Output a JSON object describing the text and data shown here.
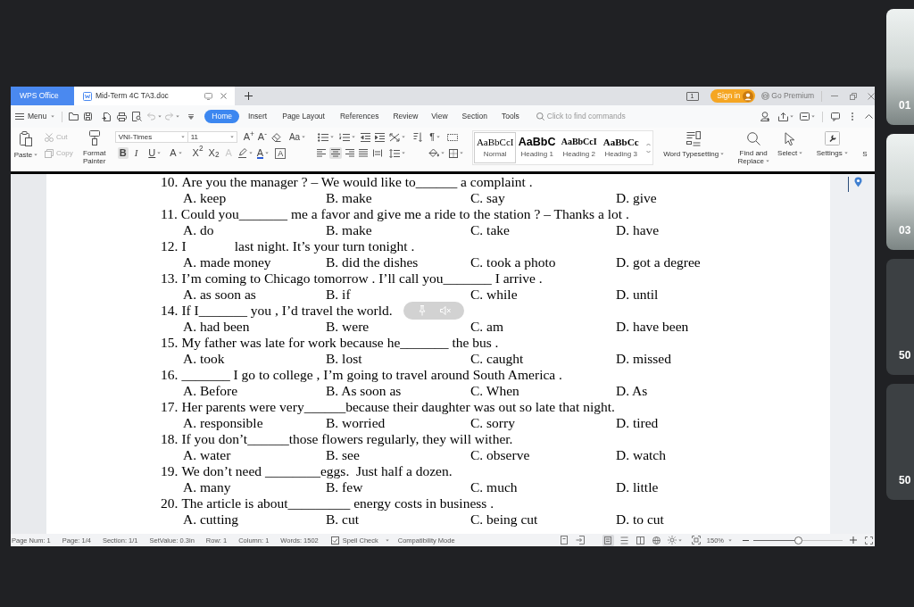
{
  "window": {
    "app_tab": "WPS Office",
    "document_tab": "Mid-Term 4C TA3.doc",
    "window_count": "1",
    "sign_in": "Sign in",
    "premium": "Go Premium"
  },
  "menu_bar": {
    "menu": "Menu",
    "tabs": [
      {
        "label": "Home",
        "selected": true
      },
      {
        "label": "Insert",
        "selected": false
      },
      {
        "label": "Page Layout",
        "selected": false
      },
      {
        "label": "References",
        "selected": false
      },
      {
        "label": "Review",
        "selected": false
      },
      {
        "label": "View",
        "selected": false
      },
      {
        "label": "Section",
        "selected": false
      },
      {
        "label": "Tools",
        "selected": false
      }
    ],
    "search": {
      "placeholder": "Click to find commands"
    }
  },
  "ribbon": {
    "paste": {
      "label": "Paste",
      "dropdown": true
    },
    "clipboard": [
      {
        "label": "Cut",
        "disabled": true
      },
      {
        "label": "Copy",
        "disabled": true
      }
    ],
    "format_painter": {
      "label": "Format Painter",
      "disabled": false
    },
    "font_name": "VNI-Times",
    "font_size": "11",
    "size_buttons": [
      "A$^{+}$",
      "A$^{-}$"
    ],
    "change_case": {
      "text": "Aa",
      "dropdown": true
    },
    "paragraph_mark": {
      "text": "¶",
      "dropdown": true
    },
    "font_styles": [
      {
        "text": "B",
        "selected": true,
        "dropdown": false,
        "disabled": false
      },
      {
        "text": "I",
        "selected": false,
        "dropdown": false,
        "disabled": false
      },
      {
        "text": "U",
        "selected": false,
        "dropdown": true,
        "disabled": false
      },
      {
        "text": "A",
        "selected": false,
        "dropdown": true,
        "disabled": false
      },
      {
        "text": "X$^{2}$",
        "selected": false,
        "dropdown": false,
        "disabled": false
      },
      {
        "text": "X$_{2}$",
        "selected": false,
        "dropdown": false,
        "disabled": false
      },
      {
        "text": "A",
        "selected": false,
        "dropdown": false,
        "disabled": true
      }
    ],
    "font_color": {
      "text": "A",
      "dropdown": true
    },
    "character_border": {
      "text": "A"
    },
    "alignment": [
      {
        "selected": false
      },
      {
        "selected": true
      },
      {
        "selected": false
      },
      {
        "selected": false
      },
      {
        "selected": false
      }
    ],
    "styles": [
      {
        "preview": "AaBbCcI",
        "label": "Normal",
        "selected": true
      },
      {
        "preview": "AaBbC",
        "label": "Heading 1",
        "selected": false
      },
      {
        "preview": "AaBbCcI",
        "label": "Heading 2",
        "selected": false
      },
      {
        "preview": "AaBbCc",
        "label": "Heading 3",
        "selected": false
      }
    ],
    "tools": [
      {
        "label": "Word Typesetting",
        "dropdown": true
      },
      {
        "label": "Find and Replace",
        "dropdown": true
      },
      {
        "label": "Select",
        "dropdown": true
      },
      {
        "label": "Settings",
        "dropdown": true
      },
      {
        "label": "S",
        "dropdown": false
      }
    ]
  },
  "document": {
    "questions": [
      {
        "number": "10.",
        "text": "Are you the manager ? – We would like to______ a complaint .",
        "options": [
          "A. keep",
          "B. make",
          "C. say",
          "D. give"
        ]
      },
      {
        "number": "11.",
        "text": "Could you_______ me a favor and give me a ride to the station ? – Thanks a lot .",
        "options": [
          "A. do",
          "B. make",
          "C. take",
          "D. have"
        ]
      },
      {
        "number": "12.",
        "text": "I              last night. It’s your turn tonight .",
        "options": [
          "A. made money",
          "B. did the dishes",
          "C. took a photo",
          "D. got a degree"
        ]
      },
      {
        "number": "13.",
        "text": "I’m coming to Chicago tomorrow . I’ll call you_______ I arrive .",
        "options": [
          "A. as soon as",
          "B. if",
          "C. while",
          "D. until"
        ]
      },
      {
        "number": "14.",
        "text": "If I_______ you , I’d travel the world.",
        "options": [
          "A. had been",
          "B. were",
          "C. am",
          "D. have been"
        ]
      },
      {
        "number": "15.",
        "text": "My father was late for work because he_______ the bus .",
        "options": [
          "A. took",
          "B. lost",
          "C. caught",
          "D. missed"
        ]
      },
      {
        "number": "16.",
        "text": "_______ I go to college , I’m going to travel around South America .",
        "options": [
          "A. Before",
          "B. As soon as",
          "C. When",
          "D. As"
        ]
      },
      {
        "number": "17.",
        "text": "Her parents were very______because their daughter was out so late that night.",
        "options": [
          "A. responsible",
          "B. worried",
          "C. sorry",
          "D. tired"
        ]
      },
      {
        "number": "18.",
        "text": "If you don’t______those flowers regularly, they will wither.",
        "options": [
          "A. water",
          "B. see",
          "C. observe",
          "D. watch"
        ]
      },
      {
        "number": "19.",
        "text": "We don’t need ________eggs.  Just half a dozen.",
        "options": [
          "A. many",
          "B. few",
          "C. much",
          "D. little"
        ]
      },
      {
        "number": "20.",
        "text": "The article is about_________ energy costs in business .",
        "options": [
          "A. cutting",
          "B. cut",
          "C. being cut",
          "D. to cut"
        ]
      }
    ]
  },
  "status_bar": {
    "fields": [
      "Page Num: 1",
      "Page: 1/4",
      "Section: 1/1",
      "SetValue: 0.3in",
      "Row: 1",
      "Column: 1",
      "Words: 1502"
    ],
    "spell_check": {
      "label": "Spell Check",
      "checked": true
    },
    "mode": "Compatibility Mode",
    "view_modes": [
      {
        "selected": true
      },
      {
        "selected": false
      },
      {
        "selected": false
      },
      {
        "selected": false
      }
    ],
    "zoom": {
      "value": "150%",
      "level": 0.5
    }
  },
  "participants": [
    {
      "label": "01",
      "video": true
    },
    {
      "label": "03",
      "video": true
    },
    {
      "label": "50",
      "video": false
    },
    {
      "label": "50",
      "video": false
    }
  ]
}
